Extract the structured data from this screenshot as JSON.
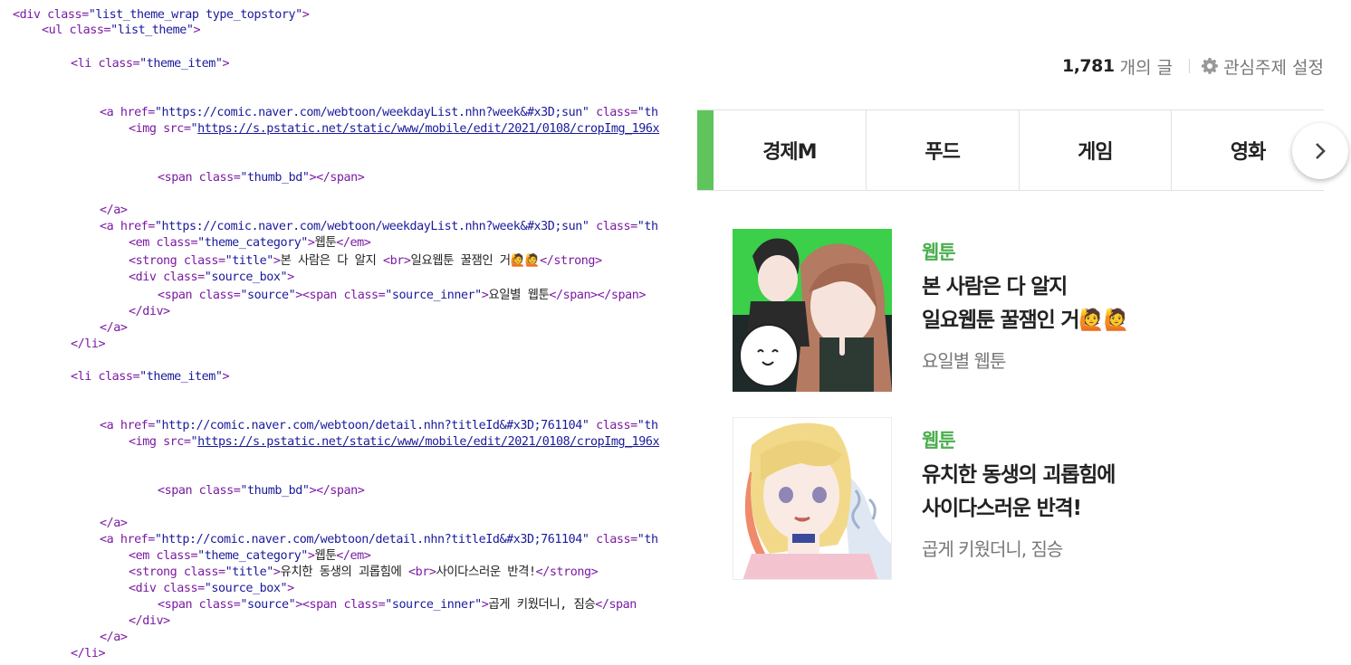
{
  "code": {
    "lines": [
      {
        "indent": 0,
        "parts": [
          [
            "tag",
            "<div "
          ],
          [
            "at",
            "class="
          ],
          [
            "val",
            "\"list_theme_wrap type_topstory\""
          ],
          [
            "tag",
            ">"
          ]
        ]
      },
      {
        "indent": 1,
        "parts": [
          [
            "tag",
            "<ul "
          ],
          [
            "at",
            "class="
          ],
          [
            "val",
            "\"list_theme\""
          ],
          [
            "tag",
            ">"
          ]
        ]
      },
      {
        "indent": 2,
        "parts": [
          [
            "tag",
            "<li "
          ],
          [
            "at",
            "class="
          ],
          [
            "val",
            "\"theme_item\""
          ],
          [
            "tag",
            ">"
          ]
        ]
      },
      {
        "indent": 3,
        "parts": [
          [
            "tag",
            "<a "
          ],
          [
            "at",
            "href="
          ],
          [
            "val",
            "\"https://comic.naver.com/webtoon/weekdayList.nhn?week&#x3D;sun\" "
          ],
          [
            "at",
            "class="
          ],
          [
            "val",
            "\"th"
          ]
        ]
      },
      {
        "indent": 4,
        "parts": [
          [
            "tag",
            "<img "
          ],
          [
            "at",
            "src="
          ],
          [
            "val",
            "\""
          ],
          [
            "lnk",
            "https://s.pstatic.net/static/www/mobile/edit/2021/0108/cropImg_196x"
          ]
        ]
      },
      {
        "indent": 5,
        "parts": [
          [
            "tag",
            "<span "
          ],
          [
            "at",
            "class="
          ],
          [
            "val",
            "\"thumb_bd\""
          ],
          [
            "tag",
            "></span>"
          ]
        ]
      },
      {
        "indent": 3,
        "parts": [
          [
            "tag",
            "</a>"
          ]
        ]
      },
      {
        "indent": 3,
        "parts": [
          [
            "tag",
            "<a "
          ],
          [
            "at",
            "href="
          ],
          [
            "val",
            "\"https://comic.naver.com/webtoon/weekdayList.nhn?week&#x3D;sun\" "
          ],
          [
            "at",
            "class="
          ],
          [
            "val",
            "\"th"
          ]
        ]
      },
      {
        "indent": 4,
        "parts": [
          [
            "tag",
            "<em "
          ],
          [
            "at",
            "class="
          ],
          [
            "val",
            "\"theme_category\""
          ],
          [
            "tag",
            ">"
          ],
          [
            "txt",
            "웹툰"
          ],
          [
            "tag",
            "</em>"
          ]
        ]
      },
      {
        "indent": 4,
        "parts": [
          [
            "tag",
            "<strong "
          ],
          [
            "at",
            "class="
          ],
          [
            "val",
            "\"title\""
          ],
          [
            "tag",
            ">"
          ],
          [
            "txt",
            "본 사람은 다 알지 "
          ],
          [
            "tag",
            "<br>"
          ],
          [
            "txt",
            "일요웹툰 꿀잼인 거🙋🙋"
          ],
          [
            "tag",
            "</strong>"
          ]
        ]
      },
      {
        "indent": 4,
        "parts": [
          [
            "tag",
            "<div "
          ],
          [
            "at",
            "class="
          ],
          [
            "val",
            "\"source_box\""
          ],
          [
            "tag",
            ">"
          ]
        ]
      },
      {
        "indent": 5,
        "parts": [
          [
            "tag",
            "<span "
          ],
          [
            "at",
            "class="
          ],
          [
            "val",
            "\"source\""
          ],
          [
            "tag",
            "><span "
          ],
          [
            "at",
            "class="
          ],
          [
            "val",
            "\"source_inner\""
          ],
          [
            "tag",
            ">"
          ],
          [
            "txt",
            "요일별 웹툰"
          ],
          [
            "tag",
            "</span></span>"
          ]
        ]
      },
      {
        "indent": 4,
        "parts": [
          [
            "tag",
            "</div>"
          ]
        ]
      },
      {
        "indent": 3,
        "parts": [
          [
            "tag",
            "</a>"
          ]
        ]
      },
      {
        "indent": 2,
        "parts": [
          [
            "tag",
            "</li>"
          ]
        ]
      },
      {
        "indent": 2,
        "parts": [
          [
            "tag",
            "<li "
          ],
          [
            "at",
            "class="
          ],
          [
            "val",
            "\"theme_item\""
          ],
          [
            "tag",
            ">"
          ]
        ]
      },
      {
        "indent": 3,
        "parts": [
          [
            "tag",
            "<a "
          ],
          [
            "at",
            "href="
          ],
          [
            "val",
            "\"http://comic.naver.com/webtoon/detail.nhn?titleId&#x3D;761104\" "
          ],
          [
            "at",
            "class="
          ],
          [
            "val",
            "\"th"
          ]
        ]
      },
      {
        "indent": 4,
        "parts": [
          [
            "tag",
            "<img "
          ],
          [
            "at",
            "src="
          ],
          [
            "val",
            "\""
          ],
          [
            "lnk",
            "https://s.pstatic.net/static/www/mobile/edit/2021/0108/cropImg_196x"
          ]
        ]
      },
      {
        "indent": 5,
        "parts": [
          [
            "tag",
            "<span "
          ],
          [
            "at",
            "class="
          ],
          [
            "val",
            "\"thumb_bd\""
          ],
          [
            "tag",
            "></span>"
          ]
        ]
      },
      {
        "indent": 3,
        "parts": [
          [
            "tag",
            "</a>"
          ]
        ]
      },
      {
        "indent": 3,
        "parts": [
          [
            "tag",
            "<a "
          ],
          [
            "at",
            "href="
          ],
          [
            "val",
            "\"http://comic.naver.com/webtoon/detail.nhn?titleId&#x3D;761104\" "
          ],
          [
            "at",
            "class="
          ],
          [
            "val",
            "\"th"
          ]
        ]
      },
      {
        "indent": 4,
        "parts": [
          [
            "tag",
            "<em "
          ],
          [
            "at",
            "class="
          ],
          [
            "val",
            "\"theme_category\""
          ],
          [
            "tag",
            ">"
          ],
          [
            "txt",
            "웹툰"
          ],
          [
            "tag",
            "</em>"
          ]
        ]
      },
      {
        "indent": 4,
        "parts": [
          [
            "tag",
            "<strong "
          ],
          [
            "at",
            "class="
          ],
          [
            "val",
            "\"title\""
          ],
          [
            "tag",
            ">"
          ],
          [
            "txt",
            "유치한 동생의 괴롭힘에 "
          ],
          [
            "tag",
            "<br>"
          ],
          [
            "txt",
            "사이다스러운 반격!"
          ],
          [
            "tag",
            "</strong>"
          ]
        ]
      },
      {
        "indent": 4,
        "parts": [
          [
            "tag",
            "<div "
          ],
          [
            "at",
            "class="
          ],
          [
            "val",
            "\"source_box\""
          ],
          [
            "tag",
            ">"
          ]
        ]
      },
      {
        "indent": 5,
        "parts": [
          [
            "tag",
            "<span "
          ],
          [
            "at",
            "class="
          ],
          [
            "val",
            "\"source\""
          ],
          [
            "tag",
            "><span "
          ],
          [
            "at",
            "class="
          ],
          [
            "val",
            "\"source_inner\""
          ],
          [
            "tag",
            ">"
          ],
          [
            "txt",
            "곱게 키웠더니, 짐승"
          ],
          [
            "tag",
            "</span"
          ]
        ]
      },
      {
        "indent": 4,
        "parts": [
          [
            "tag",
            "</div>"
          ]
        ]
      },
      {
        "indent": 3,
        "parts": [
          [
            "tag",
            "</a>"
          ]
        ]
      },
      {
        "indent": 2,
        "parts": [
          [
            "tag",
            "</li>"
          ]
        ]
      }
    ]
  },
  "header": {
    "count": "1,781",
    "count_suffix": "개의 글",
    "settings_label": "관심주제 설정"
  },
  "tabs": [
    "경제M",
    "푸드",
    "게임",
    "영화"
  ],
  "items": [
    {
      "category": "웹툰",
      "title_line1": "본 사람은 다 알지",
      "title_line2": "일요웹툰 꿀잼인 거🙋🙋",
      "source": "요일별 웹툰"
    },
    {
      "category": "웹툰",
      "title_line1": "유치한 동생의 괴롭힘에",
      "title_line2": "사이다스러운 반격!",
      "source": "곱게 키웠더니, 짐승"
    }
  ],
  "colors": {
    "accent_green": "#5fc45c",
    "category_green": "#4cae4e",
    "code_tag": "#7b1aa3",
    "code_value": "#1a1a9c"
  }
}
